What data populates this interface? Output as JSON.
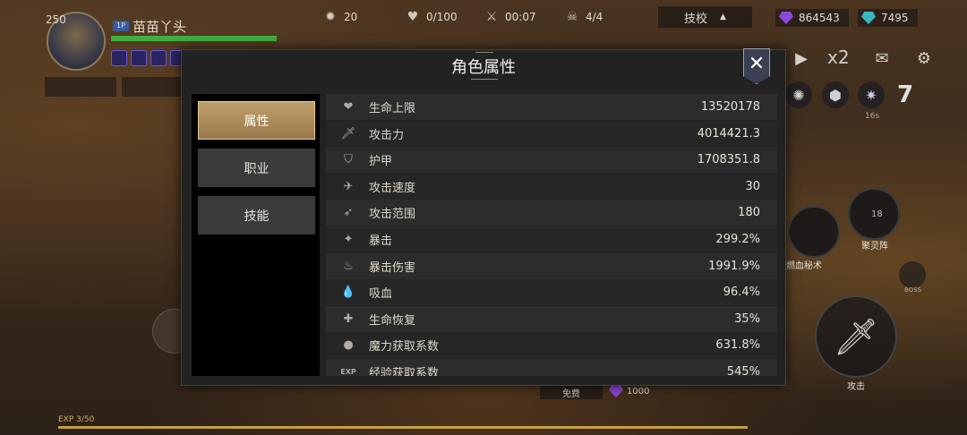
{
  "hud": {
    "level": "250",
    "player_badge": "1P",
    "player_name": "苗苗丫头",
    "hp_fill": 1.0,
    "kills": "20",
    "hp": "0/100",
    "time": "00:07",
    "bosses": "4/4",
    "skill_button": "技校",
    "gems_purple": "864543",
    "gems_teal": "7495",
    "speed": "x2",
    "cooldown": "16s",
    "skill_ready": "7",
    "skill_cd_value": "18",
    "skill_1_label": "燃血秘术",
    "skill_2_label": "聚灵阵",
    "boss_label": "BOSS",
    "attack_label": "攻击",
    "free_label": "免费",
    "cost": "1000",
    "exp_text": "EXP 3/50",
    "exp_fill": 1.0
  },
  "modal": {
    "title": "角色属性",
    "close_icon": "close-icon",
    "tabs": [
      {
        "label": "属性",
        "active": true
      },
      {
        "label": "职业",
        "active": false
      },
      {
        "label": "技能",
        "active": false
      }
    ],
    "attributes": [
      {
        "icon": "heart-icon",
        "glyph": "❤",
        "name": "生命上限",
        "value": "13520178"
      },
      {
        "icon": "sword-icon",
        "glyph": "🗡",
        "name": "攻击力",
        "value": "4014421.3"
      },
      {
        "icon": "shield-icon",
        "glyph": "⛉",
        "name": "护甲",
        "value": "1708351.8"
      },
      {
        "icon": "speed-icon",
        "glyph": "✈",
        "name": "攻击速度",
        "value": "30"
      },
      {
        "icon": "range-icon",
        "glyph": "➶",
        "name": "攻击范围",
        "value": "180"
      },
      {
        "icon": "crit-icon",
        "glyph": "✦",
        "name": "暴击",
        "value": "299.2%"
      },
      {
        "icon": "crit-damage-icon",
        "glyph": "♨",
        "name": "暴击伤害",
        "value": "1991.9%"
      },
      {
        "icon": "drop-icon",
        "glyph": "💧",
        "name": "吸血",
        "value": "96.4%"
      },
      {
        "icon": "regen-icon",
        "glyph": "✚",
        "name": "生命恢复",
        "value": "35%"
      },
      {
        "icon": "mana-icon",
        "glyph": "●",
        "name": "魔力获取系数",
        "value": "631.8%"
      },
      {
        "icon": "exp-icon",
        "glyph": "EXP",
        "name": "经验获取系数",
        "value": "545%"
      }
    ]
  }
}
